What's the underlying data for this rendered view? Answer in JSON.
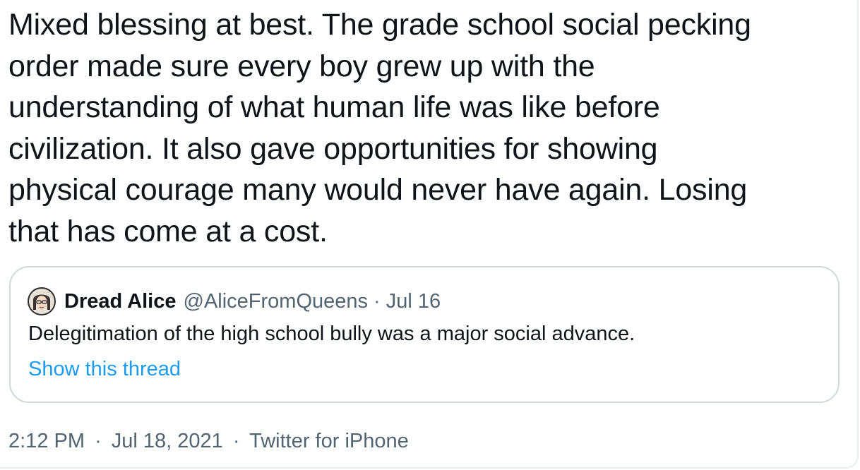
{
  "tweet": {
    "text_lines": [
      "Mixed blessing at best. The grade school social pecking",
      "order made sure every boy grew up with the",
      "understanding of what human life was like before",
      "civilization. It also gave opportunities for showing",
      "physical courage many would never have again. Losing",
      "that has come at a cost."
    ],
    "time": "2:12 PM",
    "separator": "·",
    "date": "Jul 18, 2021",
    "source": "Twitter for iPhone"
  },
  "quoted_tweet": {
    "display_name": "Dread Alice",
    "handle": "@AliceFromQueens",
    "separator": "·",
    "date": "Jul 16",
    "text": "Delegitimation of the high school bully was a major social advance.",
    "show_thread_label": "Show this thread",
    "avatar_icon": "profile-avatar"
  },
  "colors": {
    "primary_text": "#0f1419",
    "secondary_text": "#536471",
    "link": "#1d9bf0",
    "border": "#cfd9de"
  }
}
